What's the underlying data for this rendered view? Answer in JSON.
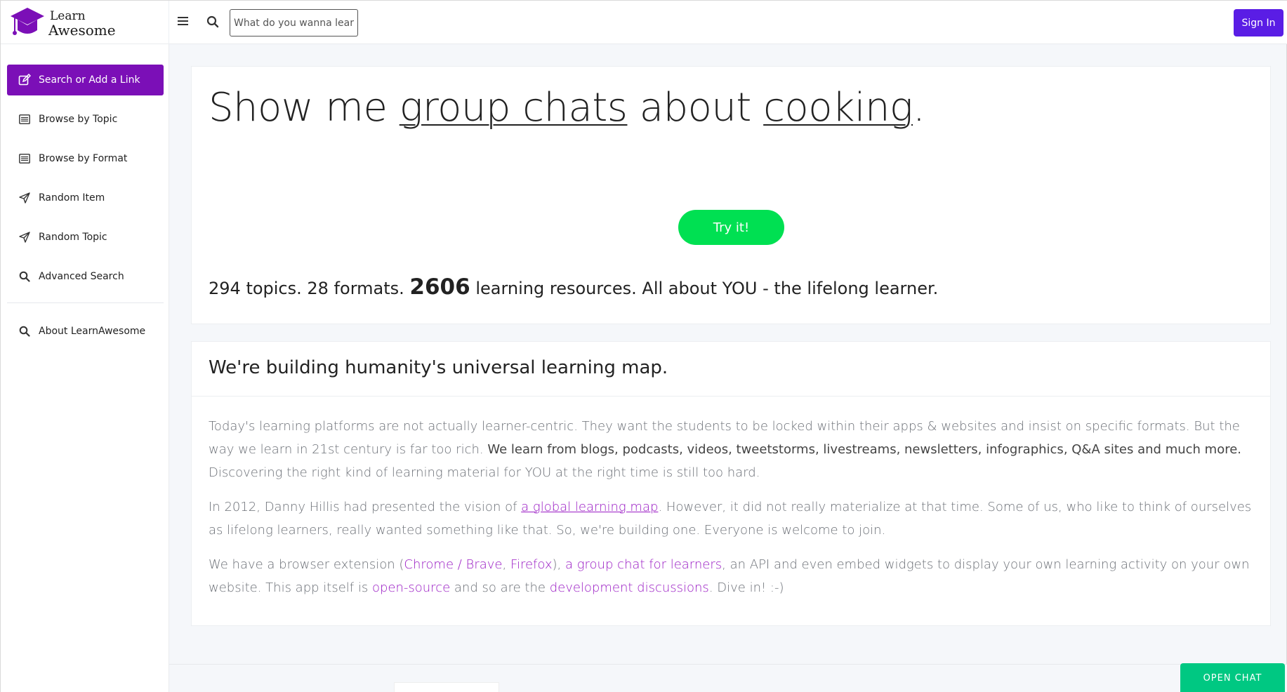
{
  "brand": {
    "line1": "Learn",
    "line2": "Awesome"
  },
  "search": {
    "placeholder": "What do you wanna learn?"
  },
  "header": {
    "signin_label": "Sign In"
  },
  "sidebar": {
    "items": [
      {
        "label": "Search or Add a Link",
        "icon": "edit-icon"
      },
      {
        "label": "Browse by Topic",
        "icon": "list-icon"
      },
      {
        "label": "Browse by Format",
        "icon": "list-icon"
      },
      {
        "label": "Random Item",
        "icon": "send-icon"
      },
      {
        "label": "Random Topic",
        "icon": "send-icon"
      },
      {
        "label": "Advanced Search",
        "icon": "search-icon"
      },
      {
        "label": "About LearnAwesome",
        "icon": "search-icon"
      }
    ]
  },
  "hero": {
    "t1": "Show me ",
    "t2": "group chats",
    "t3": " about ",
    "t4": "cooking",
    "t5": ".",
    "try_label": "Try it!",
    "stats_a": "294 topics. 28 formats. ",
    "stats_b": "2606",
    "stats_c": " learning resources. All about YOU - the lifelong learner."
  },
  "about": {
    "title": "We're building humanity's universal learning map.",
    "p1a": "Today's learning platforms are not actually learner-centric. They want the students to be locked within their apps & websites and insist on specific formats. But the way we learn in 21st century is far too rich. ",
    "p1b": "We learn from blogs, podcasts, videos, tweetstorms, livestreams, newsletters, infographics, Q&A sites and much more.",
    "p1c": " Discovering the right kind of learning material for YOU at the right time is still too hard.",
    "p2a": "In 2012, Danny Hillis had presented the vision of ",
    "p2link": "a global learning map",
    "p2b": ". However, it did not really materialize at that time. Some of us, who like to think of ourselves as lifelong learners, really wanted something like that. So, we're building one. Everyone is welcome to join.",
    "p3a": "We have a browser extension (",
    "p3l1": "Chrome / Brave",
    "p3s1": ", ",
    "p3l2": "Firefox",
    "p3s2": "), ",
    "p3l3": "a group chat for learners",
    "p3b": ", an API and even embed widgets to display your own learning activity on your own website. This app itself is ",
    "p3l4": "open-source",
    "p3c": " and so are the ",
    "p3l5": "development discussions",
    "p3d": ". Dive in! :-)"
  },
  "chat": {
    "label": "OPEN CHAT"
  },
  "colors": {
    "accent": "#7b0fb7",
    "signin": "#5a1de5",
    "try": "#00e052",
    "chat": "#00c882",
    "link": "#9a1bc4"
  }
}
